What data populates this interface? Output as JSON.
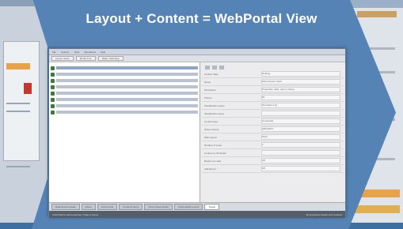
{
  "headline": "Layout + Content = WebPortal View",
  "window": {
    "menu": [
      "File",
      "Options",
      "Tools",
      "Operations",
      "Help"
    ],
    "toolbar": [
      "Layout Views",
      "Model Tree",
      "Make / Edit Map"
    ],
    "tree": [
      {
        "label": "Interface – CS (5) (Localization)"
      },
      {
        "label": "Meteorological data (5) (12) (ADD-EDIT)"
      },
      {
        "label": "Sensor profiles (5) (3) (Recorder) (ATC) (ADD-EDIT)"
      },
      {
        "label": "Aviation requirements (5) (1) (ADD-EDIT)"
      },
      {
        "label": "Equipment (5) (Telemetry Data) (ADD-EDIT)"
      },
      {
        "label": "Status Panels (5) (4) (ADD-EDIT)"
      },
      {
        "label": "Audit – Recording, dispatch – gate work (5) (ADD-EDIT)"
      },
      {
        "label": "Access Credentials (5) (ADD-EDIT)"
      }
    ],
    "props": [
      {
        "key": "Content Tags",
        "value": "Nothing"
      },
      {
        "key": "Name",
        "value": "Wind Sensor Field"
      },
      {
        "key": "Description",
        "value": "Properties, data, report, history"
      },
      {
        "key": "Priority",
        "value": "50"
      },
      {
        "key": "Visualization option",
        "value": "Text label only"
      },
      {
        "key": "Visualization query",
        "value": ""
      },
      {
        "key": "Content type",
        "value": "Composite"
      },
      {
        "key": "Script content",
        "value": "ADD-EDIT"
      },
      {
        "key": "Web Layout",
        "value": "Strict"
      },
      {
        "key": "Number of Lines",
        "value": "1"
      },
      {
        "key": "Content by ID Param",
        "value": ""
      },
      {
        "key": "Resize on Load",
        "value": "Off"
      },
      {
        "key": "Add Export",
        "value": "Off"
      }
    ],
    "tabs": [
      {
        "label": "Data Source Fields",
        "active": false
      },
      {
        "label": "Filters",
        "active": false
      },
      {
        "label": "Control Info",
        "active": false
      },
      {
        "label": "Contents Items",
        "active": false
      },
      {
        "label": "Cross Views Fields",
        "active": false
      },
      {
        "label": "Cross attach events",
        "active": false
      },
      {
        "label": "Toggle",
        "active": true
      }
    ],
    "status_left": "Click Field to edit properties / Drag to layout",
    "status_right": "All properties loaded and resolved"
  },
  "colors": {
    "background": "#3d6fa3",
    "chevron": "#5583b6",
    "headline": "#ffffff"
  }
}
